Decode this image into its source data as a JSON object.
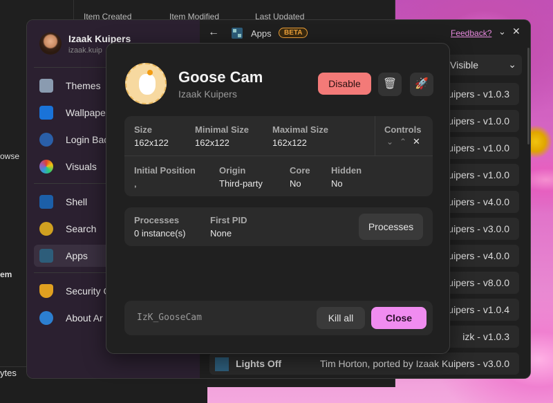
{
  "background_window": {
    "headers": [
      "Item Created",
      "Item Modified",
      "Last Updated"
    ],
    "left_tags": [
      "owse",
      "em",
      "ytes"
    ]
  },
  "profile": {
    "name": "Izaak Kuipers",
    "subtitle": "izaak.kuip"
  },
  "sidebar": {
    "items": [
      {
        "label": "Themes",
        "icon": "themes-icon",
        "color": "#8a9bb0"
      },
      {
        "label": "Wallpape",
        "icon": "wallpaper-icon",
        "color": "#1a73d8"
      },
      {
        "label": "Login Bac",
        "icon": "login-icon",
        "color": "#2a5fa8"
      },
      {
        "label": "Visuals",
        "icon": "visuals-icon",
        "color": "#e0412f"
      },
      {
        "label": "Shell",
        "icon": "shell-icon",
        "color": "#1c5fa8"
      },
      {
        "label": "Search",
        "icon": "search-icon",
        "color": "#d0a020"
      },
      {
        "label": "Apps",
        "icon": "apps-icon",
        "color": "#2d5d7a",
        "active": true
      },
      {
        "label": "Security C",
        "icon": "shield-icon",
        "color": "#e0a020"
      },
      {
        "label": "About Ar",
        "icon": "info-icon",
        "color": "#2c7fd0"
      }
    ]
  },
  "topbar": {
    "back": "←",
    "title": "Apps",
    "badge": "BETA",
    "feedback": "Feedback?"
  },
  "filter": {
    "value": "Visible"
  },
  "app_list": [
    "uipers - v1.0.3",
    "uipers - v1.0.0",
    "uipers - v1.0.0",
    "uipers - v1.0.0",
    "uipers - v4.0.0",
    "uipers - v3.0.0",
    "uipers - v4.0.0",
    "uipers - v8.0.0",
    "uipers - v1.0.4",
    "izk - v1.0.3"
  ],
  "last_row": {
    "name": "Lights Off",
    "meta": "Tim Horton, ported by Izaak Kuipers - v3.0.0"
  },
  "modal": {
    "title": "Goose Cam",
    "author": "Izaak Kuipers",
    "disable": "Disable",
    "size_label": "Size",
    "size": "162x122",
    "min_label": "Minimal Size",
    "min": "162x122",
    "max_label": "Maximal Size",
    "max": "162x122",
    "controls_label": "Controls",
    "initial_label": "Initial Position",
    "initial": ",",
    "origin_label": "Origin",
    "origin": "Third-party",
    "core_label": "Core",
    "core": "No",
    "hidden_label": "Hidden",
    "hidden": "No",
    "processes_label": "Processes",
    "processes": "0 instance(s)",
    "pid_label": "First PID",
    "pid": "None",
    "processes_button": "Processes",
    "app_id": "IzK_GooseCam",
    "kill_all": "Kill all",
    "close": "Close"
  }
}
